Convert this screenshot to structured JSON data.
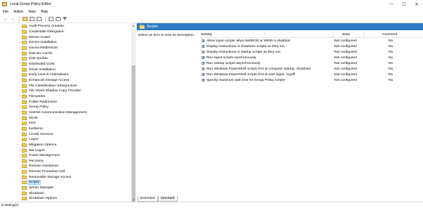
{
  "window": {
    "title": "Local Group Policy Editor",
    "controls": [
      "—",
      "☐",
      "✕"
    ]
  },
  "menu": [
    "File",
    "Action",
    "View",
    "Help"
  ],
  "toolbar": {
    "icons": [
      "back-arrow-icon",
      "forward-arrow-icon",
      "up-folder-icon",
      "show-tree-icon",
      "export-list-icon",
      "properties-icon",
      "help-icon",
      "filter-icon"
    ]
  },
  "tree": {
    "items": [
      {
        "label": "Audit Process Creation",
        "expandable": false
      },
      {
        "label": "Credentials Delegation",
        "expandable": false
      },
      {
        "label": "Device Guard",
        "expandable": false
      },
      {
        "label": "Device Installation",
        "expandable": true
      },
      {
        "label": "Device Redirection",
        "expandable": true
      },
      {
        "label": "Disk NV Cache",
        "expandable": false
      },
      {
        "label": "Disk Quotas",
        "expandable": false
      },
      {
        "label": "Distributed COM",
        "expandable": true
      },
      {
        "label": "Driver Installation",
        "expandable": false
      },
      {
        "label": "Early Launch Antimalware",
        "expandable": false
      },
      {
        "label": "Enhanced Storage Access",
        "expandable": false
      },
      {
        "label": "File Classification Infrastructure",
        "expandable": false
      },
      {
        "label": "File Share Shadow Copy Provider",
        "expandable": false
      },
      {
        "label": "Filesystem",
        "expandable": true
      },
      {
        "label": "Folder Redirection",
        "expandable": false
      },
      {
        "label": "Group Policy",
        "expandable": true
      },
      {
        "label": "Internet Communication Management",
        "expandable": true
      },
      {
        "label": "iSCSI",
        "expandable": true
      },
      {
        "label": "KDC",
        "expandable": false
      },
      {
        "label": "Kerberos",
        "expandable": false
      },
      {
        "label": "Locale Services",
        "expandable": false
      },
      {
        "label": "Logon",
        "expandable": false
      },
      {
        "label": "Mitigation Options",
        "expandable": false
      },
      {
        "label": "Net Logon",
        "expandable": true
      },
      {
        "label": "Power Management",
        "expandable": true
      },
      {
        "label": "Recovery",
        "expandable": false
      },
      {
        "label": "Remote Assistance",
        "expandable": false
      },
      {
        "label": "Remote Procedure Call",
        "expandable": false
      },
      {
        "label": "Removable Storage Access",
        "expandable": false
      },
      {
        "label": "Scripts",
        "expandable": false,
        "selected": true
      },
      {
        "label": "Server Manager",
        "expandable": false
      },
      {
        "label": "Shutdown",
        "expandable": false
      },
      {
        "label": "Shutdown Options",
        "expandable": false
      }
    ]
  },
  "content": {
    "header": "Scripts",
    "description": "Select an item to view its description.",
    "columns": {
      "setting": "Setting",
      "state": "State",
      "comment": "Comment"
    },
    "rows": [
      {
        "setting": "Allow logon scripts when NetBIOS or WINS is disabled",
        "state": "Not configured",
        "comment": "No"
      },
      {
        "setting": "Display instructions in shutdown scripts as they run",
        "state": "Not configured",
        "comment": "No"
      },
      {
        "setting": "Display instructions in startup scripts as they run",
        "state": "Not configured",
        "comment": "No"
      },
      {
        "setting": "Run logon scripts synchronously",
        "state": "Not configured",
        "comment": "No"
      },
      {
        "setting": "Run startup scripts asynchronously",
        "state": "Not configured",
        "comment": "No"
      },
      {
        "setting": "Run Windows PowerShell scripts first at computer startup, shutdown",
        "state": "Not configured",
        "comment": "No"
      },
      {
        "setting": "Run Windows PowerShell scripts first at user logon, logoff",
        "state": "Not configured",
        "comment": "No"
      },
      {
        "setting": "Specify maximum wait time for Group Policy scripts",
        "state": "Not configured",
        "comment": "No"
      }
    ]
  },
  "tabs": [
    "Extended",
    "Standard"
  ],
  "status": "8 setting(s)",
  "colors": {
    "header_bar": "#2b79c2",
    "selection": "#cce8ff"
  }
}
